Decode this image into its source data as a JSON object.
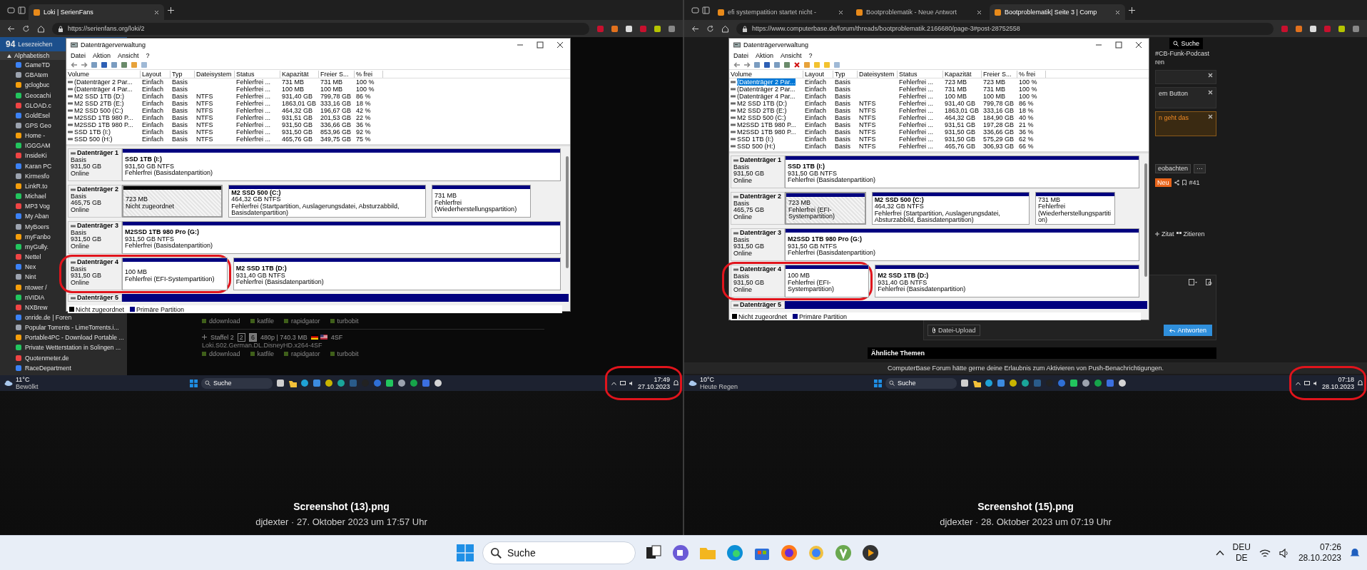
{
  "viewer": {
    "screenshots": [
      {
        "browser": {
          "tabs": [
            {
              "title": "Loki | SerienFans",
              "selected": true
            }
          ],
          "url": "https://serienfans.org/loki/2"
        },
        "page": {
          "kind": "bookmarks",
          "count": "94",
          "title": "Lesezeichen",
          "group": "Alphabetisch",
          "items": [
            "GameTD",
            "GBAtem",
            "gclogbuc",
            "Geocachi",
            "GLOAD.c",
            "GoldEsel",
            "GPS Geo",
            "Home - ",
            "IGGGAM",
            "InsideKi",
            "Karan PC",
            "Kirmesfo",
            "LinkR.to",
            "Michael",
            "MP3 Vog",
            "My Aban",
            "MyBoers",
            "myFanbo",
            "myGully.",
            "Nettel",
            "Nex",
            "Nint",
            "ntower /",
            "nVIDIA",
            "NXBrew",
            "onride.de | Foren",
            "Popular Torrents - LimeTorrents.i...",
            "Portable4PC - Download Portable ...",
            "Private Wetterstation in Solingen ...",
            "Quotenmeter.de",
            "RaceDepartment"
          ],
          "release": {
            "links_top": [
              "ddownload",
              "katfile",
              "rapidgator",
              "turbobit"
            ],
            "season": "Staffel 2",
            "versions": [
              {
                "label": "2",
                "selected": false
              },
              {
                "label": "6",
                "selected": true
              }
            ],
            "info": "480p | 740.3 MB",
            "group": "4SF",
            "file": "Loki.S02.German.DL.DisneyHD.x264-4SF",
            "links": [
              "ddownload",
              "katfile",
              "rapidgator",
              "turbobit"
            ]
          }
        },
        "disk_manager": {
          "title": "Datenträgerverwaltung",
          "menu": [
            "Datei",
            "Aktion",
            "Ansicht",
            "?"
          ],
          "volume_tools": false,
          "columns": [
            "Volume",
            "Layout",
            "Typ",
            "Dateisystem",
            "Status",
            "Kapazität",
            "Freier S...",
            "% frei"
          ],
          "rows": [
            {
              "selected": false,
              "cells": [
                "(Datenträger 2 Par...",
                "Einfach",
                "Basis",
                "",
                "Fehlerfrei ...",
                "731 MB",
                "731 MB",
                "100 %"
              ]
            },
            {
              "selected": false,
              "cells": [
                "(Datenträger 4 Par...",
                "Einfach",
                "Basis",
                "",
                "Fehlerfrei ...",
                "100 MB",
                "100 MB",
                "100 %"
              ]
            },
            {
              "selected": false,
              "cells": [
                "M2 SSD 1TB (D:)",
                "Einfach",
                "Basis",
                "NTFS",
                "Fehlerfrei ...",
                "931,40 GB",
                "799,78 GB",
                "86 %"
              ]
            },
            {
              "selected": false,
              "cells": [
                "M2 SSD 2TB (E:)",
                "Einfach",
                "Basis",
                "NTFS",
                "Fehlerfrei ...",
                "1863,01 GB",
                "333,16 GB",
                "18 %"
              ]
            },
            {
              "selected": false,
              "cells": [
                "M2 SSD 500 (C:)",
                "Einfach",
                "Basis",
                "NTFS",
                "Fehlerfrei ...",
                "464,32 GB",
                "196,67 GB",
                "42 %"
              ]
            },
            {
              "selected": false,
              "cells": [
                "M2SSD 1TB 980 P...",
                "Einfach",
                "Basis",
                "NTFS",
                "Fehlerfrei ...",
                "931,51 GB",
                "201,53 GB",
                "22 %"
              ]
            },
            {
              "selected": false,
              "cells": [
                "M2SSD 1TB 980 P...",
                "Einfach",
                "Basis",
                "NTFS",
                "Fehlerfrei ...",
                "931,50 GB",
                "336,66 GB",
                "36 %"
              ]
            },
            {
              "selected": false,
              "cells": [
                "SSD 1TB (I:)",
                "Einfach",
                "Basis",
                "NTFS",
                "Fehlerfrei ...",
                "931,50 GB",
                "853,96 GB",
                "92 %"
              ]
            },
            {
              "selected": false,
              "cells": [
                "SSD 500 (H:)",
                "Einfach",
                "Basis",
                "NTFS",
                "Fehlerfrei ...",
                "465,76 GB",
                "349,75 GB",
                "75 %"
              ]
            }
          ],
          "disks": [
            {
              "kind": "full",
              "name": "Datenträger 1",
              "type": "Basis",
              "size": "931,50 GB",
              "status": "Online",
              "partitions": [
                {
                  "kind": "primary",
                  "selected": false,
                  "name": "SSD 1TB  (I:)",
                  "size": "931,50 GB NTFS",
                  "status": "Fehlerfrei (Basisdatenpartition)"
                }
              ]
            },
            {
              "kind": "full",
              "name": "Datenträger 2",
              "type": "Basis",
              "size": "465,75 GB",
              "status": "Online",
              "partitions": [
                {
                  "kind": "unallocated",
                  "selected": true,
                  "size": "723 MB",
                  "status": "Nicht zugeordnet"
                },
                {
                  "kind": "primary",
                  "selected": false,
                  "name": "M2 SSD 500  (C:)",
                  "size": "464,32 GB NTFS",
                  "status": "Fehlerfrei (Startpartition, Auslagerungsdatei, Absturzabbild, Basisdatenpartition)"
                },
                {
                  "kind": "primary",
                  "selected": false,
                  "size": "731 MB",
                  "status": "Fehlerfrei (Wiederherstellungspartition)"
                }
              ]
            },
            {
              "kind": "full",
              "name": "Datenträger 3",
              "type": "Basis",
              "size": "931,50 GB",
              "status": "Online",
              "partitions": [
                {
                  "kind": "primary",
                  "selected": false,
                  "name": "M2SSD 1TB 980 Pro  (G:)",
                  "size": "931,50 GB NTFS",
                  "status": "Fehlerfrei (Basisdatenpartition)"
                }
              ]
            },
            {
              "kind": "full",
              "name": "Datenträger 4",
              "type": "Basis",
              "size": "931,50 GB",
              "status": "Online",
              "partitions": [
                {
                  "kind": "primary",
                  "selected": false,
                  "size": "100 MB",
                  "status": "Fehlerfrei (EFI-Systempartition)"
                },
                {
                  "kind": "primary",
                  "selected": false,
                  "name": "M2 SSD 1TB  (D:)",
                  "size": "931,40 GB NTFS",
                  "status": "Fehlerfrei (Basisdatenpartition)"
                }
              ]
            },
            {
              "kind": "partial",
              "name": "Datenträger 5"
            }
          ],
          "legend": [
            {
              "label": "Nicht zugeordnet",
              "color": "#000000"
            },
            {
              "label": "Primäre Partition",
              "color": "#00007f"
            }
          ]
        },
        "taskbar": {
          "temp": "11°C",
          "weather": "Bewölkt",
          "search": "Suche",
          "time": "17:49",
          "date": "27.10.2023"
        },
        "highlights": {
          "disk": true,
          "tray": true
        },
        "caption": {
          "file": "Screenshot (13).png",
          "meta": "djdexter · 27. Oktober 2023 um 17:57 Uhr"
        }
      },
      {
        "browser": {
          "tabs": [
            {
              "title": "efi systempatition startet nicht -",
              "selected": false
            },
            {
              "title": "Bootproblematik - Neue Antwort",
              "selected": false
            },
            {
              "title": "Bootproblematik| Seite 3 | Comp",
              "selected": true
            }
          ],
          "url": "https://www.computerbase.de/forum/threads/bootproblematik.2166680/page-3#post-28752558"
        },
        "page": {
          "kind": "forum",
          "search": "Suche",
          "podcast": "#CB-Funk-Podcast",
          "nav": "ren",
          "notices": [
            {
              "kind": "plain"
            },
            {
              "kind": "plain",
              "text": "em Button"
            },
            {
              "kind": "warning",
              "text": "n geht das"
            }
          ],
          "watch": "eobachten",
          "more": "···",
          "badge": "Neu",
          "post_number": "#41",
          "actions": [
            "Zitat",
            "Zitieren"
          ],
          "upload": "Datei-Upload",
          "reply": "Antworten",
          "similar": "Ähnliche Themen",
          "push": "ComputerBase Forum hätte gerne deine Erlaubnis zum Aktivieren von Push-Benachrichtigungen."
        },
        "disk_manager": {
          "title": "Datenträgerverwaltung",
          "menu": [
            "Datei",
            "Aktion",
            "Ansicht",
            "?"
          ],
          "volume_tools": true,
          "columns": [
            "Volume",
            "Layout",
            "Typ",
            "Dateisystem",
            "Status",
            "Kapazität",
            "Freier S...",
            "% frei"
          ],
          "rows": [
            {
              "selected": true,
              "cells": [
                "(Datenträger 2 Par...",
                "Einfach",
                "Basis",
                "",
                "Fehlerfrei ...",
                "723 MB",
                "723 MB",
                "100 %"
              ]
            },
            {
              "selected": false,
              "cells": [
                "(Datenträger 2 Par...",
                "Einfach",
                "Basis",
                "",
                "Fehlerfrei ...",
                "731 MB",
                "731 MB",
                "100 %"
              ]
            },
            {
              "selected": false,
              "cells": [
                "(Datenträger 4 Par...",
                "Einfach",
                "Basis",
                "",
                "Fehlerfrei ...",
                "100 MB",
                "100 MB",
                "100 %"
              ]
            },
            {
              "selected": false,
              "cells": [
                "M2 SSD 1TB (D:)",
                "Einfach",
                "Basis",
                "NTFS",
                "Fehlerfrei ...",
                "931,40 GB",
                "799,78 GB",
                "86 %"
              ]
            },
            {
              "selected": false,
              "cells": [
                "M2 SSD 2TB (E:)",
                "Einfach",
                "Basis",
                "NTFS",
                "Fehlerfrei ...",
                "1863,01 GB",
                "333,16 GB",
                "18 %"
              ]
            },
            {
              "selected": false,
              "cells": [
                "M2 SSD 500 (C:)",
                "Einfach",
                "Basis",
                "NTFS",
                "Fehlerfrei ...",
                "464,32 GB",
                "184,90 GB",
                "40 %"
              ]
            },
            {
              "selected": false,
              "cells": [
                "M2SSD 1TB 980 P...",
                "Einfach",
                "Basis",
                "NTFS",
                "Fehlerfrei ...",
                "931,51 GB",
                "197,28 GB",
                "21 %"
              ]
            },
            {
              "selected": false,
              "cells": [
                "M2SSD 1TB 980 P...",
                "Einfach",
                "Basis",
                "NTFS",
                "Fehlerfrei ...",
                "931,50 GB",
                "336,66 GB",
                "36 %"
              ]
            },
            {
              "selected": false,
              "cells": [
                "SSD 1TB (I:)",
                "Einfach",
                "Basis",
                "NTFS",
                "Fehlerfrei ...",
                "931,50 GB",
                "575,29 GB",
                "62 %"
              ]
            },
            {
              "selected": false,
              "cells": [
                "SSD 500 (H:)",
                "Einfach",
                "Basis",
                "NTFS",
                "Fehlerfrei ...",
                "465,76 GB",
                "306,93 GB",
                "66 %"
              ]
            }
          ],
          "disks": [
            {
              "kind": "full",
              "name": "Datenträger 1",
              "type": "Basis",
              "size": "931,50 GB",
              "status": "Online",
              "partitions": [
                {
                  "kind": "primary",
                  "selected": false,
                  "name": "SSD 1TB  (I:)",
                  "size": "931,50 GB NTFS",
                  "status": "Fehlerfrei (Basisdatenpartition)"
                }
              ]
            },
            {
              "kind": "full",
              "name": "Datenträger 2",
              "type": "Basis",
              "size": "465,75 GB",
              "status": "Online",
              "partitions": [
                {
                  "kind": "primary",
                  "selected": true,
                  "size": "723 MB",
                  "status": "Fehlerfrei (EFI-Systempartition)"
                },
                {
                  "kind": "primary",
                  "selected": false,
                  "name": "M2 SSD 500  (C:)",
                  "size": "464,32 GB NTFS",
                  "status": "Fehlerfrei (Startpartition, Auslagerungsdatei, Absturzabbild, Basisdatenpartition)"
                },
                {
                  "kind": "primary",
                  "selected": false,
                  "size": "731 MB",
                  "status": "Fehlerfrei (Wiederherstellungspartition)"
                }
              ]
            },
            {
              "kind": "full",
              "name": "Datenträger 3",
              "type": "Basis",
              "size": "931,50 GB",
              "status": "Online",
              "partitions": [
                {
                  "kind": "primary",
                  "selected": false,
                  "name": "M2SSD 1TB 980 Pro  (G:)",
                  "size": "931,50 GB NTFS",
                  "status": "Fehlerfrei (Basisdatenpartition)"
                }
              ]
            },
            {
              "kind": "full",
              "name": "Datenträger 4",
              "type": "Basis",
              "size": "931,50 GB",
              "status": "Online",
              "partitions": [
                {
                  "kind": "primary",
                  "selected": false,
                  "size": "100 MB",
                  "status": "Fehlerfrei (EFI-Systempartition)"
                },
                {
                  "kind": "primary",
                  "selected": false,
                  "name": "M2 SSD 1TB  (D:)",
                  "size": "931,40 GB NTFS",
                  "status": "Fehlerfrei (Basisdatenpartition)"
                }
              ]
            },
            {
              "kind": "partial",
              "name": "Datenträger 5"
            }
          ],
          "legend": [
            {
              "label": "Nicht zugeordnet",
              "color": "#000000"
            },
            {
              "label": "Primäre Partition",
              "color": "#00007f"
            }
          ]
        },
        "taskbar": {
          "temp": "10°C",
          "weather": "Heute Regen",
          "search": "Suche",
          "time": "07:18",
          "date": "28.10.2023"
        },
        "highlights": {
          "disk": true,
          "tray": true
        },
        "caption": {
          "file": "Screenshot (15).png",
          "meta": "djdexter · 28. Oktober 2023 um 07:19 Uhr"
        }
      }
    ]
  },
  "taskbar": {
    "search": "Suche",
    "language": "DEU",
    "layout": "DE",
    "time": "07:26",
    "date": "28.10.2023"
  }
}
